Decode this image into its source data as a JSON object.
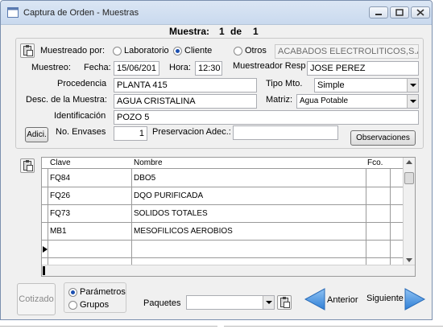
{
  "window": {
    "title": "Captura de Orden - Muestras"
  },
  "header": {
    "muestra_label": "Muestra:",
    "muestra_num": "1",
    "de_label": "de",
    "muestra_total": "1"
  },
  "form": {
    "muestreado_por_label": "Muestreado por:",
    "radio_laboratorio": "Laboratorio",
    "radio_cliente": "Cliente",
    "radio_otros": "Otros",
    "selected_muestreado": "Cliente",
    "otros_value": "ACABADOS ELECTROLITICOS,S.A. D",
    "muestreo_label": "Muestreo:",
    "fecha_label": "Fecha:",
    "fecha_value": "15/06/201",
    "hora_label": "Hora:",
    "hora_value": "12:30",
    "muestreador_label": "Muestreador Resp",
    "muestreador_value": "JOSE PEREZ",
    "procedencia_label": "Procedencia",
    "procedencia_value": "PLANTA 415",
    "tipo_mto_label": "Tipo Mto.",
    "tipo_mto_value": "Simple",
    "desc_label": "Desc. de la Muestra:",
    "desc_value": "AGUA CRISTALINA",
    "matriz_label": "Matriz:",
    "matriz_value": "Agua Potable",
    "identificacion_label": "Identificación",
    "identificacion_value": "POZO 5",
    "adici_button": "Adici.",
    "no_envases_label": "No. Envases",
    "no_envases_value": "1",
    "preservacion_label": "Preservacion Adec.:",
    "preservacion_value": "",
    "observaciones_button": "Observaciones"
  },
  "table": {
    "columns": [
      "Clave",
      "Nombre",
      "Fco."
    ],
    "rows": [
      {
        "clave": "FQ84",
        "nombre": "DBO5"
      },
      {
        "clave": "FQ26",
        "nombre": "DQO  PURIFICADA"
      },
      {
        "clave": "FQ73",
        "nombre": "SOLIDOS  TOTALES"
      },
      {
        "clave": "MB1",
        "nombre": "MESOFILICOS AEROBIOS"
      }
    ]
  },
  "footer": {
    "cotizado_button": "Cotizado",
    "radio_parametros": "Parámetros",
    "radio_grupos": "Grupos",
    "selected_tipo": "Parámetros",
    "paquetes_label": "Paquetes",
    "paquetes_value": "",
    "anterior_label": "Anterior",
    "siguiente_label": "Siguiente"
  },
  "colors": {
    "accent_arrow": "#3d8ee0",
    "title_bar": "#d4e1f2"
  }
}
